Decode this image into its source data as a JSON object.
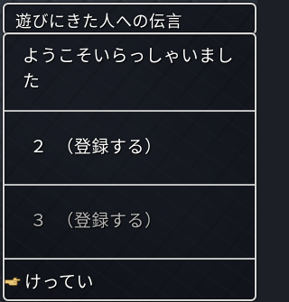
{
  "window": {
    "title": "遊びにきた人への伝言"
  },
  "menu": {
    "items": [
      {
        "label": "ようこそいらっしゃいました"
      },
      {
        "label": "２　（登録する）"
      },
      {
        "label": "３　（登録する）"
      },
      {
        "label": "けってい"
      }
    ],
    "selected_index": 3,
    "cursor_icon": "pointing-hand-icon"
  },
  "colors": {
    "frame": "#d8d8d8",
    "text": "#ffffff",
    "dimmed_text": "#b5b5b5",
    "cursor": "#e8c878"
  }
}
